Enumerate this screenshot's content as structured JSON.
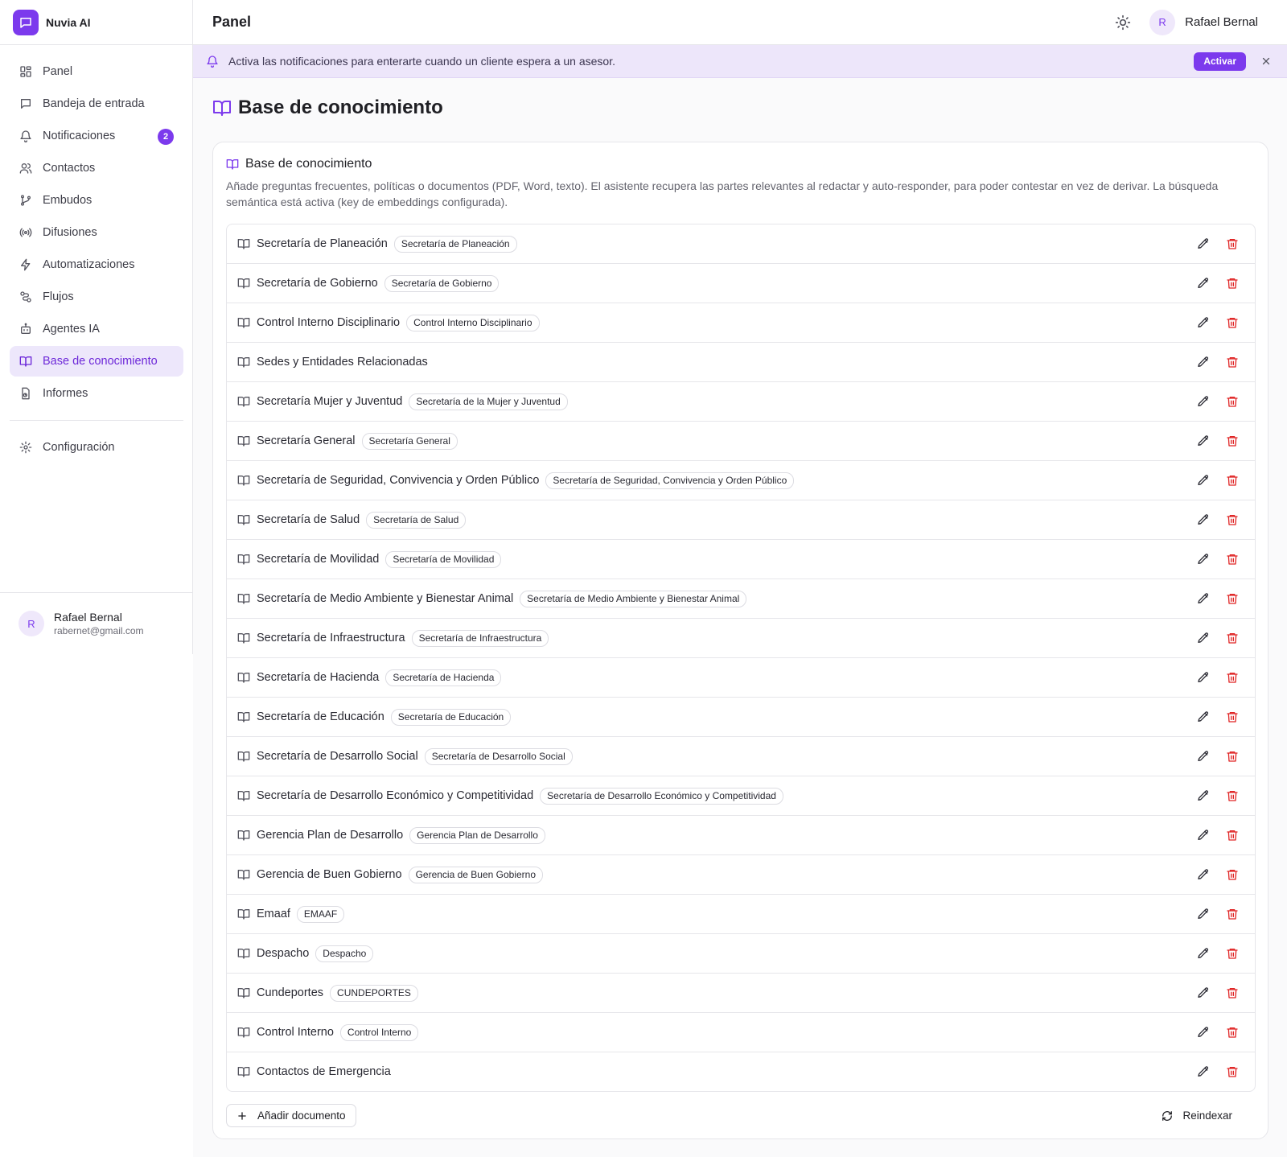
{
  "brand": {
    "name": "Nuvia AI"
  },
  "nav": {
    "items": [
      {
        "key": "panel",
        "label": "Panel",
        "icon": "dashboard-icon"
      },
      {
        "key": "inbox",
        "label": "Bandeja de entrada",
        "icon": "message-icon"
      },
      {
        "key": "notifications",
        "label": "Notificaciones",
        "icon": "bell-icon",
        "badge": "2"
      },
      {
        "key": "contacts",
        "label": "Contactos",
        "icon": "users-icon"
      },
      {
        "key": "funnels",
        "label": "Embudos",
        "icon": "git-branch-icon"
      },
      {
        "key": "broadcasts",
        "label": "Difusiones",
        "icon": "radio-icon"
      },
      {
        "key": "automations",
        "label": "Automatizaciones",
        "icon": "zap-icon"
      },
      {
        "key": "flows",
        "label": "Flujos",
        "icon": "workflow-icon"
      },
      {
        "key": "agents",
        "label": "Agentes IA",
        "icon": "bot-icon"
      },
      {
        "key": "knowledge",
        "label": "Base de conocimiento",
        "icon": "book-open-icon",
        "active": true
      },
      {
        "key": "reports",
        "label": "Informes",
        "icon": "reports-icon"
      }
    ],
    "settings": {
      "label": "Configuración",
      "icon": "gear-icon"
    }
  },
  "sidebar_user": {
    "initial": "R",
    "name": "Rafael Bernal",
    "email": "rabernet@gmail.com"
  },
  "header": {
    "title": "Panel",
    "user_initial": "R",
    "user_name": "Rafael Bernal"
  },
  "notice": {
    "text": "Activa las notificaciones para enterarte cuando un cliente espera a un asesor.",
    "button": "Activar"
  },
  "page": {
    "title": "Base de conocimiento"
  },
  "card": {
    "title": "Base de conocimiento",
    "description": "Añade preguntas frecuentes, políticas o documentos (PDF, Word, texto). El asistente recupera las partes relevantes al redactar y auto-responder, para poder contestar en vez de derivar. La búsqueda semántica está activa (key de embeddings configurada)."
  },
  "documents": [
    {
      "title": "Secretaría de Planeación",
      "tag": "Secretaría de Planeación"
    },
    {
      "title": "Secretaría de Gobierno",
      "tag": "Secretaría de Gobierno"
    },
    {
      "title": "Control Interno Disciplinario",
      "tag": "Control Interno Disciplinario"
    },
    {
      "title": "Sedes y Entidades Relacionadas",
      "tag": ""
    },
    {
      "title": "Secretaría Mujer y Juventud",
      "tag": "Secretaría de la Mujer y Juventud"
    },
    {
      "title": "Secretaría General",
      "tag": "Secretaría General"
    },
    {
      "title": "Secretaría de Seguridad, Convivencia y Orden Público",
      "tag": "Secretaría de Seguridad, Convivencia y Orden Público"
    },
    {
      "title": "Secretaría de Salud",
      "tag": "Secretaría de Salud"
    },
    {
      "title": "Secretaría de Movilidad",
      "tag": "Secretaría de Movilidad"
    },
    {
      "title": "Secretaría de Medio Ambiente y Bienestar Animal",
      "tag": "Secretaría de Medio Ambiente y Bienestar Animal"
    },
    {
      "title": "Secretaría de Infraestructura",
      "tag": "Secretaría de Infraestructura"
    },
    {
      "title": "Secretaría de Hacienda",
      "tag": "Secretaría de Hacienda"
    },
    {
      "title": "Secretaría de Educación",
      "tag": "Secretaría de Educación"
    },
    {
      "title": "Secretaría de Desarrollo Social",
      "tag": "Secretaría de Desarrollo Social"
    },
    {
      "title": "Secretaría de Desarrollo Económico y Competitividad",
      "tag": "Secretaría de Desarrollo Económico y Competitividad"
    },
    {
      "title": "Gerencia Plan de Desarrollo",
      "tag": "Gerencia Plan de Desarrollo"
    },
    {
      "title": "Gerencia de Buen Gobierno",
      "tag": "Gerencia de Buen Gobierno"
    },
    {
      "title": "Emaaf",
      "tag": "EMAAF"
    },
    {
      "title": "Despacho",
      "tag": "Despacho"
    },
    {
      "title": "Cundeportes",
      "tag": "CUNDEPORTES"
    },
    {
      "title": "Control Interno",
      "tag": "Control Interno"
    },
    {
      "title": "Contactos de Emergencia",
      "tag": ""
    }
  ],
  "actions": {
    "add_label": "Añadir documento",
    "reindex_label": "Reindexar"
  },
  "colors": {
    "accent": "#7c3aed",
    "accent_soft": "#ede7fb",
    "danger": "#e02424"
  }
}
